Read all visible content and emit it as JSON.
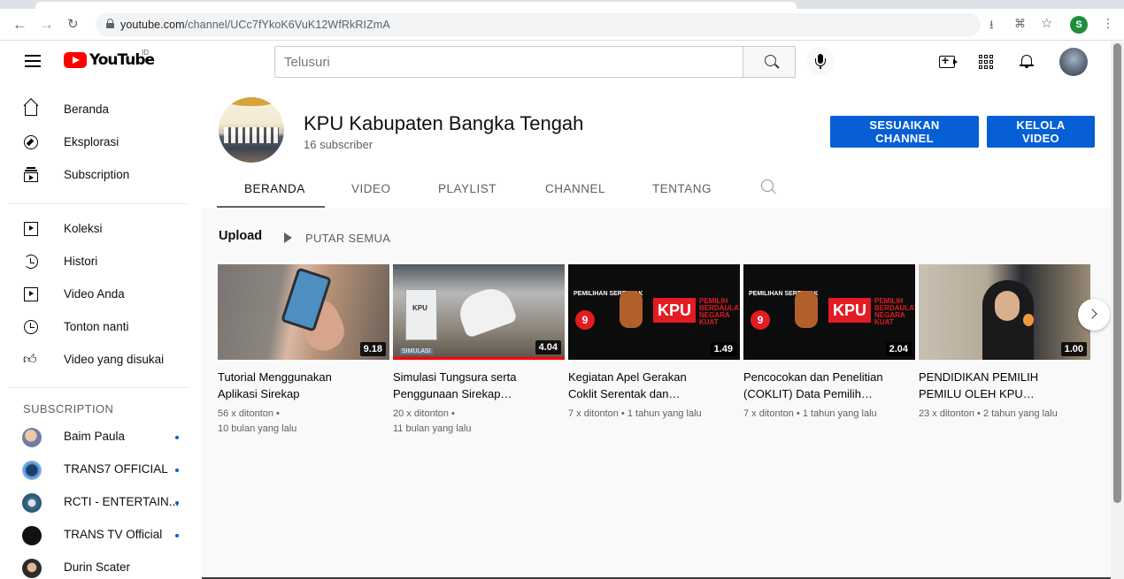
{
  "browser": {
    "url_host": "youtube.com",
    "url_path": "/channel/UCc7fYkoK6VuK12WfRkRIZmA",
    "profile_initial": "S"
  },
  "masthead": {
    "logo_text": "YouTube",
    "country_code": "ID",
    "search_placeholder": "Telusuri"
  },
  "sidebar": {
    "main": [
      {
        "label": "Beranda",
        "icon": "home-icon"
      },
      {
        "label": "Eksplorasi",
        "icon": "compass-icon"
      },
      {
        "label": "Subscription",
        "icon": "subscriptions-icon"
      }
    ],
    "library": [
      {
        "label": "Koleksi",
        "icon": "library-icon"
      },
      {
        "label": "Histori",
        "icon": "history-icon"
      },
      {
        "label": "Video Anda",
        "icon": "your-videos-icon"
      },
      {
        "label": "Tonton nanti",
        "icon": "watch-later-icon"
      },
      {
        "label": "Video yang disukai",
        "icon": "thumbs-up-icon"
      }
    ],
    "subscriptions_heading": "SUBSCRIPTION",
    "subscriptions": [
      {
        "label": "Baim Paula",
        "color": "#6d7fa6",
        "new": true
      },
      {
        "label": "TRANS7 OFFICIAL",
        "color": "#2f6fb8",
        "new": true
      },
      {
        "label": "RCTI - ENTERTAIN...",
        "color": "#3b6d8c",
        "new": true
      },
      {
        "label": "TRANS TV Official",
        "color": "#111111",
        "new": true
      },
      {
        "label": "Durin Scater",
        "color": "#2b2b2b",
        "new": false
      }
    ]
  },
  "channel": {
    "name": "KPU Kabupaten Bangka Tengah",
    "subscribers": "16 subscriber",
    "customize_button": "SESUAIKAN CHANNEL",
    "manage_button": "KELOLA VIDEO",
    "tabs": [
      "BERANDA",
      "VIDEO",
      "PLAYLIST",
      "CHANNEL",
      "TENTANG"
    ],
    "active_tab": "BERANDA"
  },
  "shelf": {
    "title": "Upload",
    "play_all": "PUTAR SEMUA",
    "videos": [
      {
        "title_line1": "Tutorial Menggunakan",
        "title_line2": "Aplikasi Sirekap",
        "duration": "9.18",
        "meta_line1": "56 x ditonton •",
        "meta_line2": "10 bulan yang lalu",
        "watched": 0
      },
      {
        "title_line1": "Simulasi Tungsura serta",
        "title_line2": "Penggunaan Sirekap…",
        "duration": "4.04",
        "meta_line1": "20 x ditonton •",
        "meta_line2": "11 bulan yang lalu",
        "watched": 1.0,
        "thumb_box_text": "KPU",
        "thumb_tag": "SIMULASI"
      },
      {
        "title_line1": "Kegiatan Apel Gerakan",
        "title_line2": "Coklit Serentak dan…",
        "duration": "1.49",
        "meta_line1": "7 x ditonton • 1 tahun yang lalu",
        "meta_line2": "",
        "watched": 0
      },
      {
        "title_line1": "Pencocokan dan Penelitian",
        "title_line2": "(COKLIT) Data Pemilih…",
        "duration": "2.04",
        "meta_line1": "7 x ditonton • 1 tahun yang lalu",
        "meta_line2": "",
        "watched": 0
      },
      {
        "title_line1": "PENDIDIKAN PEMILIH",
        "title_line2": "PEMILU OLEH KPU…",
        "duration": "1.00",
        "meta_line1": "23 x ditonton • 2 tahun yang lalu",
        "meta_line2": "",
        "watched": 0
      }
    ],
    "thumb_art": {
      "pemilihan": "PEMILIHAN SERENTAK",
      "nine": "9",
      "kpu": "KPU",
      "negara": "PEMILIH BERDAULAT NEGARA KUAT"
    }
  },
  "colors": {
    "accent_blue": "#065fd4",
    "brand_red": "#ff0000",
    "page_bg": "#f9f9f9"
  }
}
